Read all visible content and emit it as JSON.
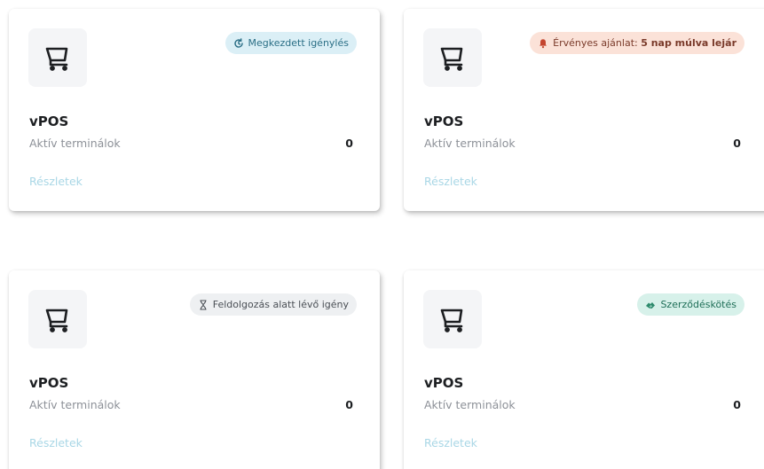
{
  "cards": [
    {
      "badge": {
        "text": "Megkezdett igénylés",
        "bold": "",
        "icon": "refresh-icon",
        "color": "#dbeff6"
      },
      "icon": "cart-icon",
      "title": "vPOS",
      "label": "Aktív terminálok",
      "value": "0",
      "link": "Részletek"
    },
    {
      "badge": {
        "text": "Érvényes ajánlat: ",
        "bold": "5 nap múlva lejár",
        "icon": "bell-icon",
        "color": "#fbe2d8"
      },
      "icon": "cart-icon",
      "title": "vPOS",
      "label": "Aktív terminálok",
      "value": "0",
      "link": "Részletek"
    },
    {
      "badge": {
        "text": "Feldolgozás alatt lévő igény",
        "bold": "",
        "icon": "hourglass-icon",
        "color": "#eef0f2"
      },
      "icon": "cart-icon",
      "title": "vPOS",
      "label": "Aktív terminálok",
      "value": "0",
      "link": "Részletek"
    },
    {
      "badge": {
        "text": "Szerződéskötés",
        "bold": "",
        "icon": "handshake-icon",
        "color": "#d7f1ea"
      },
      "icon": "cart-icon",
      "title": "vPOS",
      "label": "Aktív terminálok",
      "value": "0",
      "link": "Részletek"
    }
  ]
}
